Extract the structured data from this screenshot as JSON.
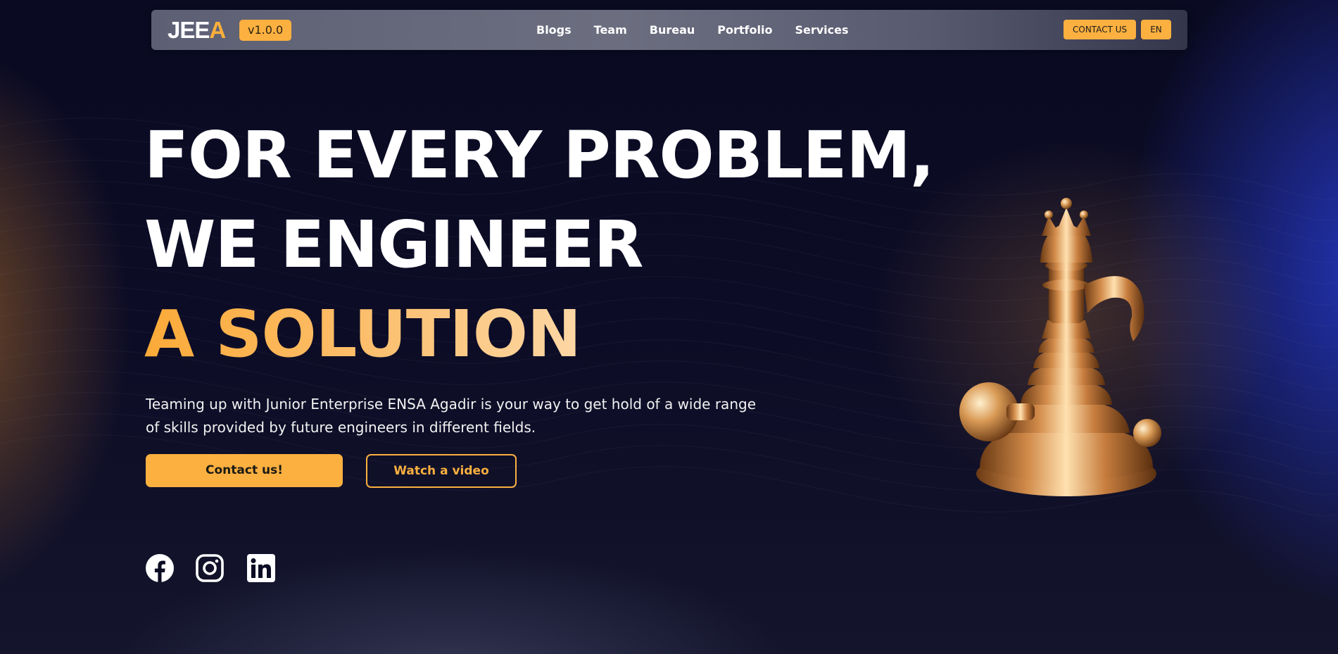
{
  "navbar": {
    "logo": {
      "part1": "JEE",
      "part2": "A"
    },
    "version": "v1.0.0",
    "links": [
      "Blogs",
      "Team",
      "Bureau",
      "Portfolio",
      "Services"
    ],
    "contact_label": "CONTACT US",
    "language": "EN"
  },
  "hero": {
    "line1": "FOR EVERY PROBLEM,",
    "line2": "WE ENGINEER",
    "line3": "A SOLUTION",
    "subtitle": "Teaming up with Junior Enterprise ENSA Agadir is your way to get hold of a wide range of skills provided by future engineers in different fields.",
    "primary_button": "Contact us!",
    "secondary_button": "Watch a video"
  },
  "social": {
    "icons": [
      "facebook-icon",
      "instagram-icon",
      "linkedin-icon"
    ]
  },
  "colors": {
    "accent": "#fbb040",
    "background": "#0b0b24",
    "text": "#ffffff"
  }
}
